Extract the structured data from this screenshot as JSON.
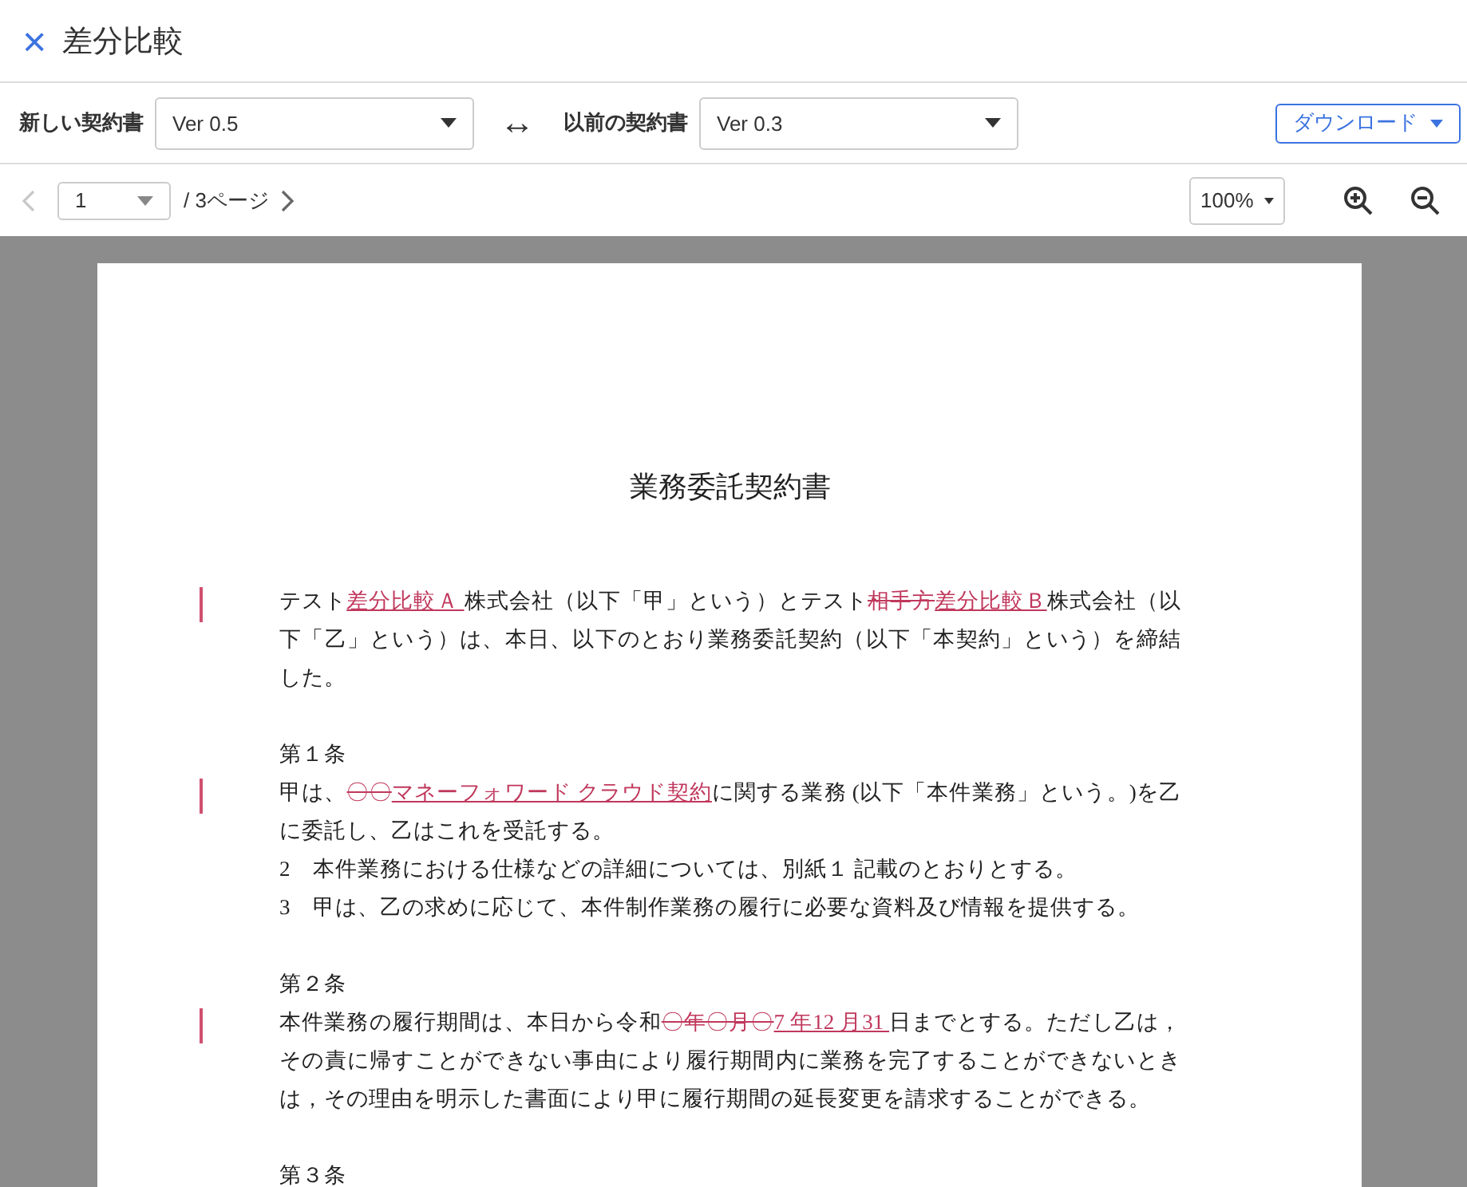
{
  "header": {
    "close": "×",
    "title": "差分比較"
  },
  "toolbar": {
    "new_label": "新しい契約書",
    "new_value": "Ver 0.5",
    "swap": "↔",
    "old_label": "以前の契約書",
    "old_value": "Ver 0.3",
    "download": "ダウンロード"
  },
  "pager": {
    "page": "1",
    "total": "/ 3ページ",
    "zoom": "100%"
  },
  "document": {
    "title": "業務委託契約書",
    "blocks": [
      {
        "kind": "para",
        "segments": [
          {
            "kind": "plain",
            "text": "テスト"
          },
          {
            "kind": "ins",
            "text": "差分比較Ａ "
          },
          {
            "kind": "plain",
            "text": "株式会社（以下「甲」という）とテスト"
          },
          {
            "kind": "del",
            "text": "相手方"
          },
          {
            "kind": "ins",
            "text": "差分比較Ｂ"
          },
          {
            "kind": "plain",
            "text": "株式会社（以下「乙」という）は、本日、以下のとおり業務委託契約（以下「本契約」という）を締結した。"
          }
        ]
      },
      {
        "kind": "heading",
        "segments": [
          {
            "kind": "plain",
            "text": "第１条"
          }
        ]
      },
      {
        "kind": "para",
        "segments": [
          {
            "kind": "plain",
            "text": "甲は、"
          },
          {
            "kind": "del",
            "text": "〇〇"
          },
          {
            "kind": "ins",
            "text": "マネーフォワード クラウド契約"
          },
          {
            "kind": "plain",
            "text": "に関する業務 (以下「本件業務」という。)を乙に委託し、乙はこれを受託する。"
          }
        ]
      },
      {
        "kind": "line",
        "segments": [
          {
            "kind": "plain",
            "text": "2　本件業務における仕様などの詳細については、別紙１ 記載のとおりとする。"
          }
        ]
      },
      {
        "kind": "line",
        "segments": [
          {
            "kind": "plain",
            "text": "3　甲は、乙の求めに応じて、本件制作業務の履行に必要な資料及び情報を提供する。"
          }
        ]
      },
      {
        "kind": "heading",
        "segments": [
          {
            "kind": "plain",
            "text": "第２条"
          }
        ]
      },
      {
        "kind": "para",
        "segments": [
          {
            "kind": "plain",
            "text": "本件業務の履行期間は、本日から令和"
          },
          {
            "kind": "del",
            "text": "〇年〇月〇"
          },
          {
            "kind": "ins",
            "text": "7 年12 月31 "
          },
          {
            "kind": "plain",
            "text": "日までとする。ただし乙は，その責に帰すことができない事由により履行期間内に業務を完了することができないときは，その理由を明示した書面により甲に履行期間の延長変更を請求することができる。"
          }
        ]
      },
      {
        "kind": "heading",
        "segments": [
          {
            "kind": "plain",
            "text": "第３条"
          }
        ]
      }
    ]
  }
}
